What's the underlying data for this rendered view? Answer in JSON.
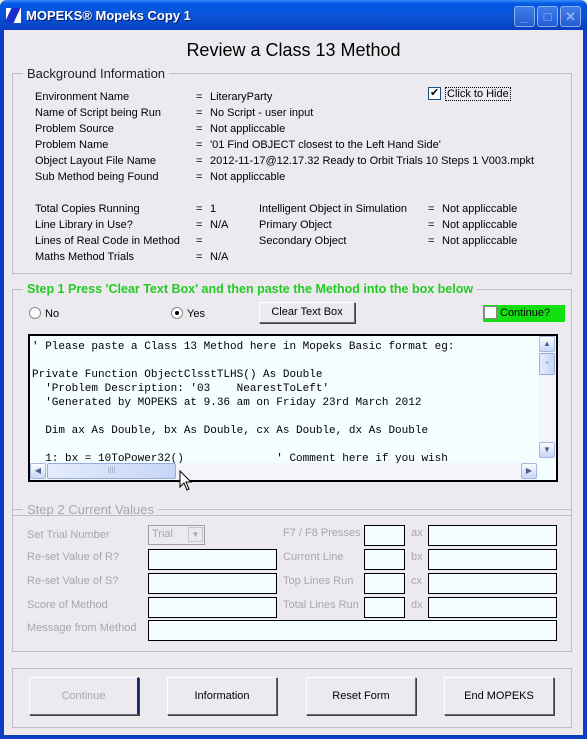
{
  "window": {
    "title": "MOPEKS® Mopeks Copy 1",
    "controls": {
      "minimize": "minimize-icon",
      "maximize": "maximize-icon",
      "close": "close-icon"
    }
  },
  "page_title": "Review a Class 13 Method",
  "background": {
    "legend": "Background Information",
    "hide_checkbox": {
      "label": "Click to Hide",
      "checked": true
    },
    "rows": [
      {
        "label": "Environment Name",
        "eq": "=",
        "value": "LiteraryParty"
      },
      {
        "label": "Name of Script being Run",
        "eq": "=",
        "value": "No Script - user input"
      },
      {
        "label": "Problem Source",
        "eq": "=",
        "value": "Not appliccable"
      },
      {
        "label": "Problem Name",
        "eq": "=",
        "value": "'01  Find OBJECT closest to the Left Hand Side'"
      },
      {
        "label": "Object Layout File Name",
        "eq": "=",
        "value": "2012-11-17@12.17.32 Ready to Orbit Trials 10 Steps 1 V003.mpkt"
      },
      {
        "label": "Sub Method being Found",
        "eq": "=",
        "value": "Not appliccable"
      }
    ],
    "left_rows": [
      {
        "label": "Total Copies Running",
        "eq": "=",
        "value": "1"
      },
      {
        "label": "Line Library in Use?",
        "eq": "=",
        "value": "N/A"
      },
      {
        "label": "Lines of Real Code in Method",
        "eq": "=",
        "value": ""
      },
      {
        "label": "Maths Method Trials",
        "eq": "=",
        "value": "N/A"
      }
    ],
    "right_rows": [
      {
        "label": "Intelligent Object in Simulation",
        "eq": "=",
        "value": "Not appliccable"
      },
      {
        "label": "Primary Object",
        "eq": "=",
        "value": "Not appliccable"
      },
      {
        "label": "Secondary Object",
        "eq": "=",
        "value": "Not appliccable"
      }
    ]
  },
  "step1": {
    "legend": "Step 1  Press 'Clear Text Box' and then paste the Method into the box below",
    "legend_color": "#22cc22",
    "radio_no": {
      "label": "No",
      "selected": false
    },
    "radio_yes": {
      "label": "Yes",
      "selected": true
    },
    "clear_button": "Clear Text Box",
    "continue_checkbox": {
      "label": "Continue?",
      "checked": false,
      "bg_color": "#10e010"
    },
    "code": "' Please paste a Class 13 Method here in Mopeks Basic format eg:\n\nPrivate Function ObjectClsstTLHS() As Double\n  'Problem Description: '03    NearestToLeft'\n  'Generated by MOPEKS at 9.36 am on Friday 23rd March 2012\n\n  Dim ax As Double, bx As Double, cx As Double, dx As Double\n\n  1: bx = 10ToPower32()              ' Comment here if you wish"
  },
  "step2": {
    "legend": "Step 2   Current Values",
    "set_trial_label": "Set Trial Number",
    "trial_combo": "Trial",
    "left_fields": [
      {
        "label": "Re-set Value of R?",
        "value": ""
      },
      {
        "label": "Re-set Value of S?",
        "value": ""
      },
      {
        "label": "Score of Method",
        "value": ""
      }
    ],
    "message_label": "Message from Method",
    "message_value": "",
    "mid_fields": [
      {
        "label": "F7 / F8 Presses",
        "value": ""
      },
      {
        "label": "Current Line",
        "value": ""
      },
      {
        "label": "Top Lines Run",
        "value": ""
      },
      {
        "label": "Total Lines Run",
        "value": ""
      }
    ],
    "reg_fields": [
      {
        "label": "ax",
        "value": ""
      },
      {
        "label": "bx",
        "value": ""
      },
      {
        "label": "cx",
        "value": ""
      },
      {
        "label": "dx",
        "value": ""
      }
    ]
  },
  "buttons": {
    "continue": "Continue",
    "information": "Information",
    "reset": "Reset Form",
    "end": "End MOPEKS"
  }
}
